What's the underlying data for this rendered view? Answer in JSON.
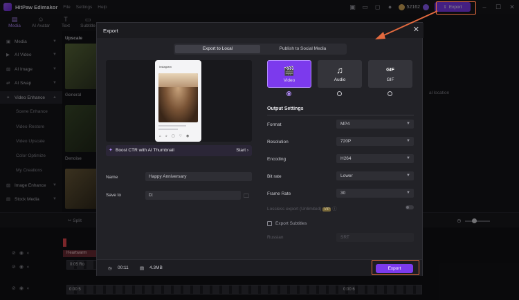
{
  "titlebar": {
    "app_name": "HitPaw Edimakor",
    "menu": [
      "File",
      "Settings",
      "Help"
    ],
    "credits": "52162",
    "export_label": "Export"
  },
  "toolbar": {
    "tools": [
      {
        "label": "Media",
        "icon": "media-icon"
      },
      {
        "label": "AI Avatar",
        "icon": "avatar-icon"
      },
      {
        "label": "Text",
        "icon": "text-icon"
      },
      {
        "label": "Subtitle",
        "icon": "subtitle-icon"
      }
    ]
  },
  "sidebar": {
    "items": [
      {
        "label": "Media"
      },
      {
        "label": "AI Video"
      },
      {
        "label": "AI Image"
      },
      {
        "label": "AI Swap"
      },
      {
        "label": "Video Enhance"
      }
    ],
    "sub_items": [
      "Scene Enhance",
      "Video Restore",
      "Video Upscale",
      "Color Optimize",
      "My Creations"
    ],
    "items_bottom": [
      {
        "label": "Image Enhance"
      },
      {
        "label": "Stock Media"
      }
    ]
  },
  "media_panel": {
    "title": "Upscale",
    "thumb_labels": [
      "General",
      "Denoise"
    ]
  },
  "right_panel": {
    "text": "al location"
  },
  "timeline": {
    "split_label": "Split",
    "track_label": "Heartwarm",
    "clip_time_1": "0:05 Ro",
    "clip_time_2": "0:00 5",
    "clip_time_3": "0:00 6"
  },
  "export_dialog": {
    "title": "Export",
    "tabs": [
      "Export to Local",
      "Publish to Social Media"
    ],
    "boost_text": "Boost CTR with AI Thumbnail",
    "boost_start": "Start",
    "name_label": "Name",
    "name_value": "Happy Anniversary",
    "save_label": "Save to",
    "save_value": "D:",
    "formats": [
      {
        "label": "Video",
        "icon": "video-icon",
        "selected": true
      },
      {
        "label": "Audio",
        "icon": "music-note-icon",
        "selected": false
      },
      {
        "label": "GIF",
        "icon": "gif-icon",
        "selected": false
      }
    ],
    "output_settings_title": "Output Settings",
    "settings": [
      {
        "label": "Format",
        "value": "MP4"
      },
      {
        "label": "Resolution",
        "value": "720P"
      },
      {
        "label": "Encoding",
        "value": "H264"
      },
      {
        "label": "Bit rate",
        "value": "Lower"
      },
      {
        "label": "Frame Rate",
        "value": "30"
      }
    ],
    "lossless_label": "Lossless export (Unlimited)",
    "vip_badge": "VIP",
    "subtitles_label": "Export Subtitles",
    "subtitle_lang_label": "Russian",
    "subtitle_format": "SRT",
    "duration": "00:11",
    "file_size": "4.3MB",
    "export_label": "Export",
    "phone_header": "Instagram"
  },
  "colors": {
    "accent": "#7c3aed",
    "highlight": "#e36a3f"
  }
}
